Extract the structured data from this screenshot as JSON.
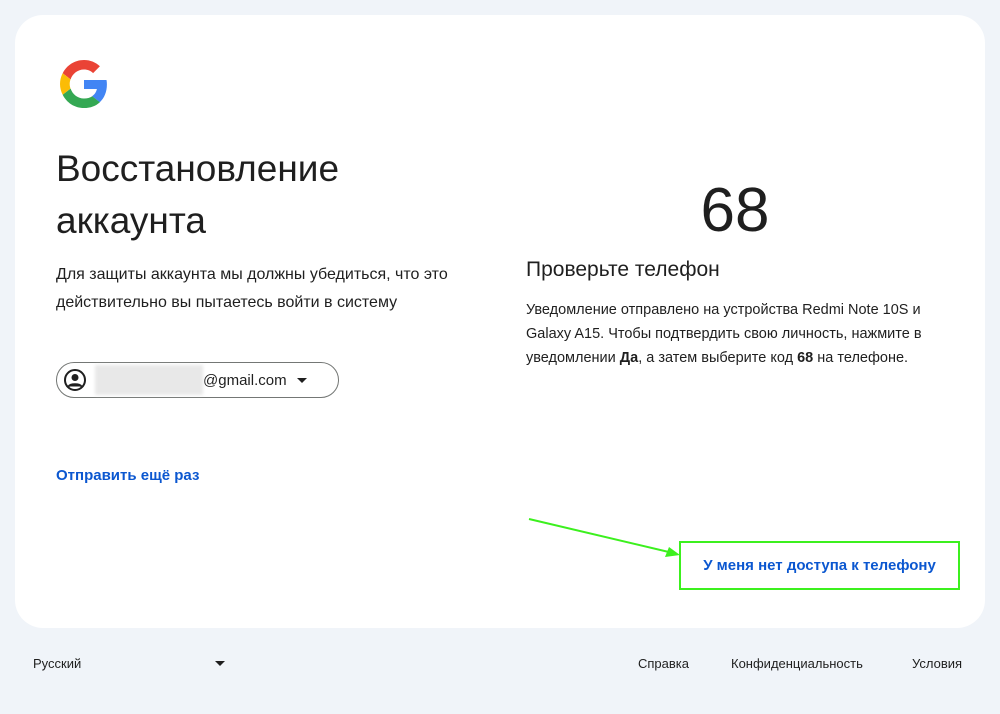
{
  "header": {
    "title": "Восстановление аккаунта",
    "description": "Для защиты аккаунта мы должны убедиться, что это действительно вы пытаетесь войти в систему"
  },
  "account": {
    "email_suffix": "@gmail.com"
  },
  "resend_link": "Отправить ещё раз",
  "verification": {
    "code": "68",
    "subtitle": "Проверьте телефон",
    "text_1": "Уведомление отправлено на устройства Redmi Note 10S и Galaxy A15. Чтобы подтвердить свою личность, нажмите в уведомлении ",
    "bold_yes": "Да",
    "text_2": ", а затем выберите код ",
    "bold_code": "68",
    "text_3": " на телефоне."
  },
  "no_access_link": "У меня нет доступа к телефону",
  "footer": {
    "language": "Русский",
    "help": "Справка",
    "privacy": "Конфиденциальность",
    "terms": "Условия"
  },
  "colors": {
    "link": "#0b57d0",
    "highlight": "#3cf01e"
  }
}
